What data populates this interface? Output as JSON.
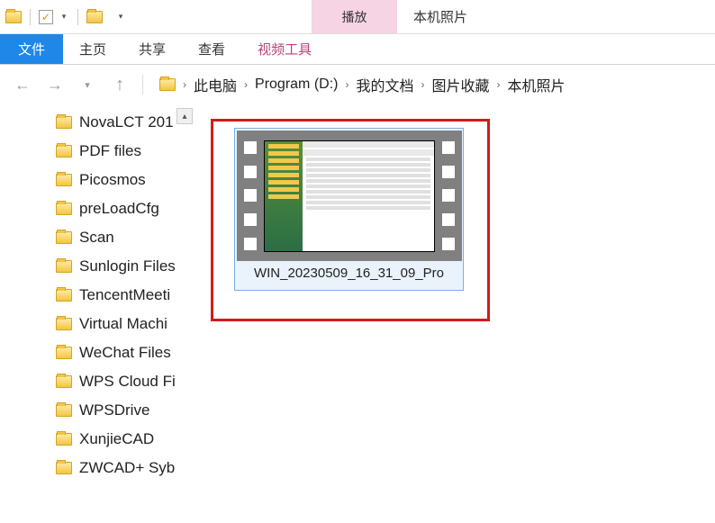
{
  "title": {
    "contextual_label": "播放",
    "window_title": "本机照片"
  },
  "ribbon": {
    "file": "文件",
    "tabs": [
      "主页",
      "共享",
      "查看"
    ],
    "contextual_tab": "视频工具"
  },
  "breadcrumbs": {
    "items": [
      "此电脑",
      "Program (D:)",
      "我的文档",
      "图片收藏",
      "本机照片"
    ]
  },
  "tree": {
    "items": [
      "NovaLCT 201",
      "PDF files",
      "Picosmos",
      "preLoadCfg",
      "Scan",
      "Sunlogin Files",
      "TencentMeeti",
      "Virtual Machi",
      "WeChat Files",
      "WPS Cloud Fi",
      "WPSDrive",
      "XunjieCAD",
      "ZWCAD+ Syb"
    ]
  },
  "files": [
    {
      "name": "WIN_20230509_16_31_09_Pro",
      "type": "video",
      "selected": true
    }
  ]
}
